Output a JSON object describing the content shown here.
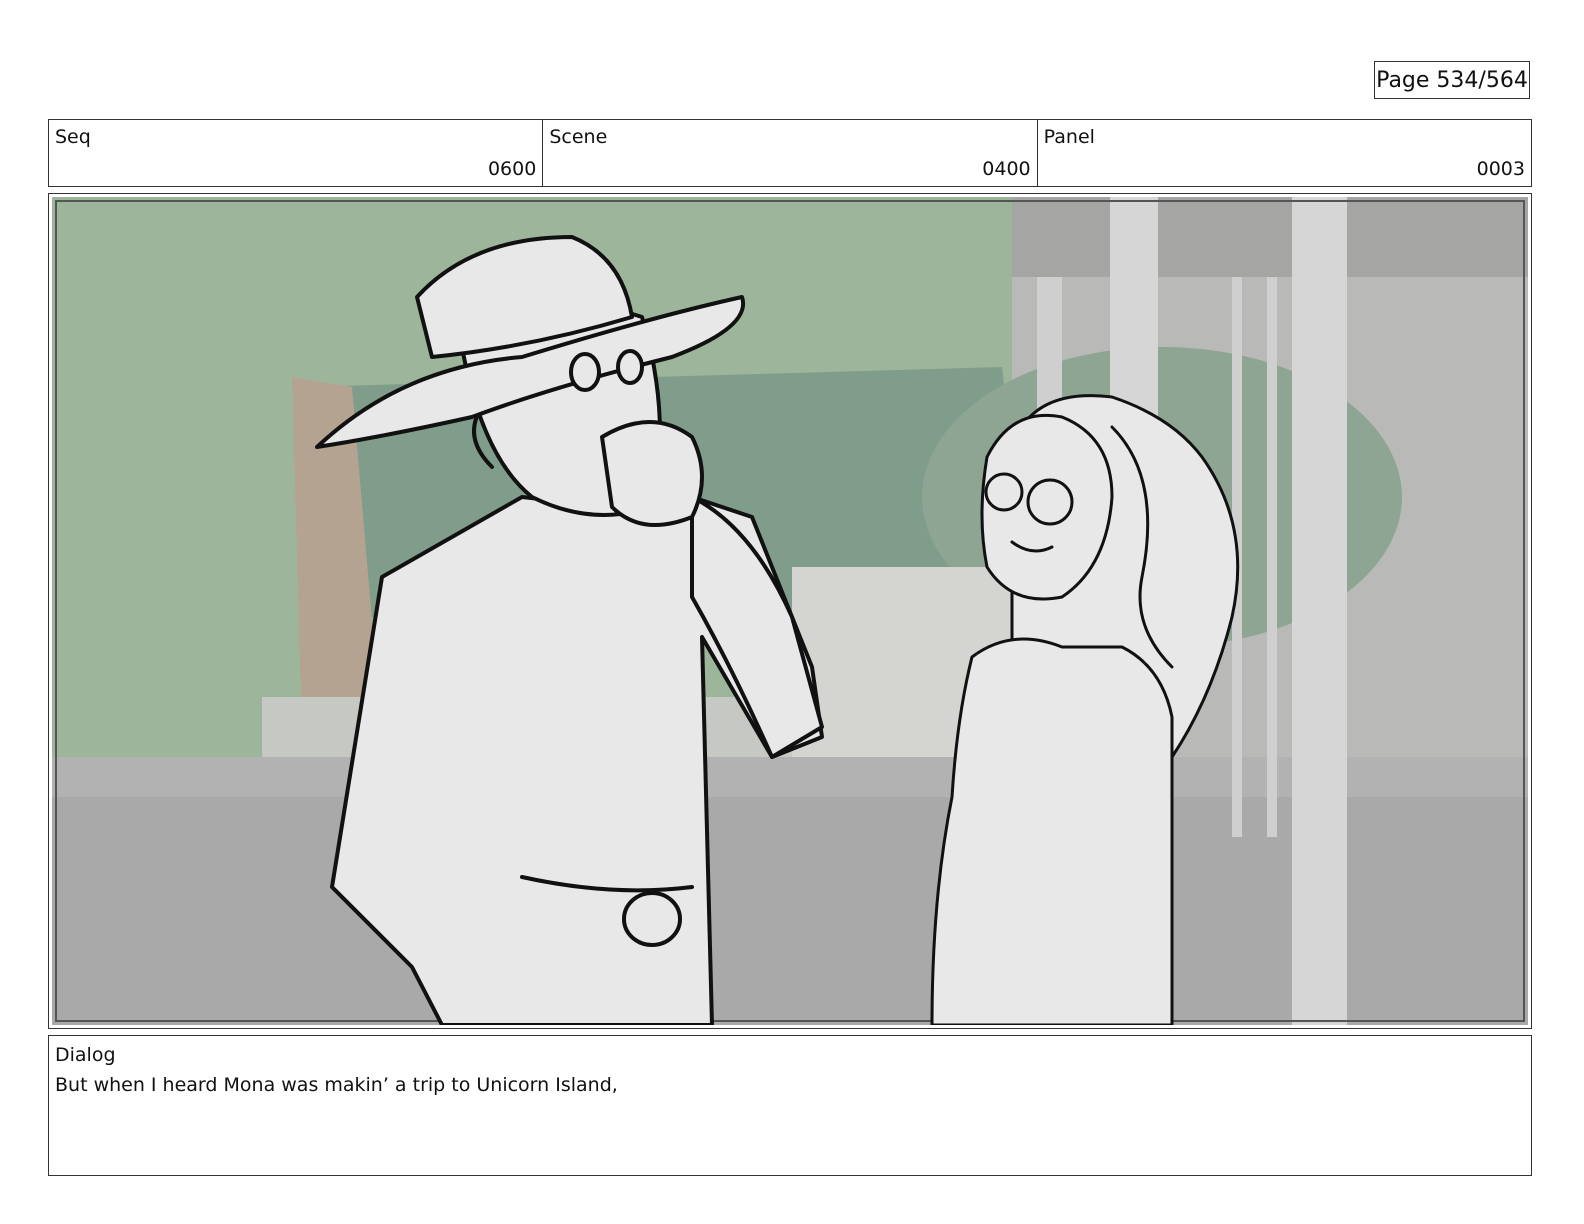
{
  "page": {
    "label": "Page 534/564"
  },
  "header": {
    "seq": {
      "label": "Seq",
      "value": "0600"
    },
    "scene": {
      "label": "Scene",
      "value": "0400"
    },
    "panel": {
      "label": "Panel",
      "value": "0003"
    }
  },
  "frame": {
    "image_description": "storyboard-sketch-cowboy-and-girl",
    "colors": {
      "sky": "#9db59a",
      "dome": "#7f9d8a",
      "ground": "#a9a9a9",
      "sketch": "#e8e8e8",
      "line": "#111111"
    }
  },
  "dialog": {
    "label": "Dialog",
    "text": "But when I heard Mona was makin’ a trip to Unicorn Island,"
  }
}
